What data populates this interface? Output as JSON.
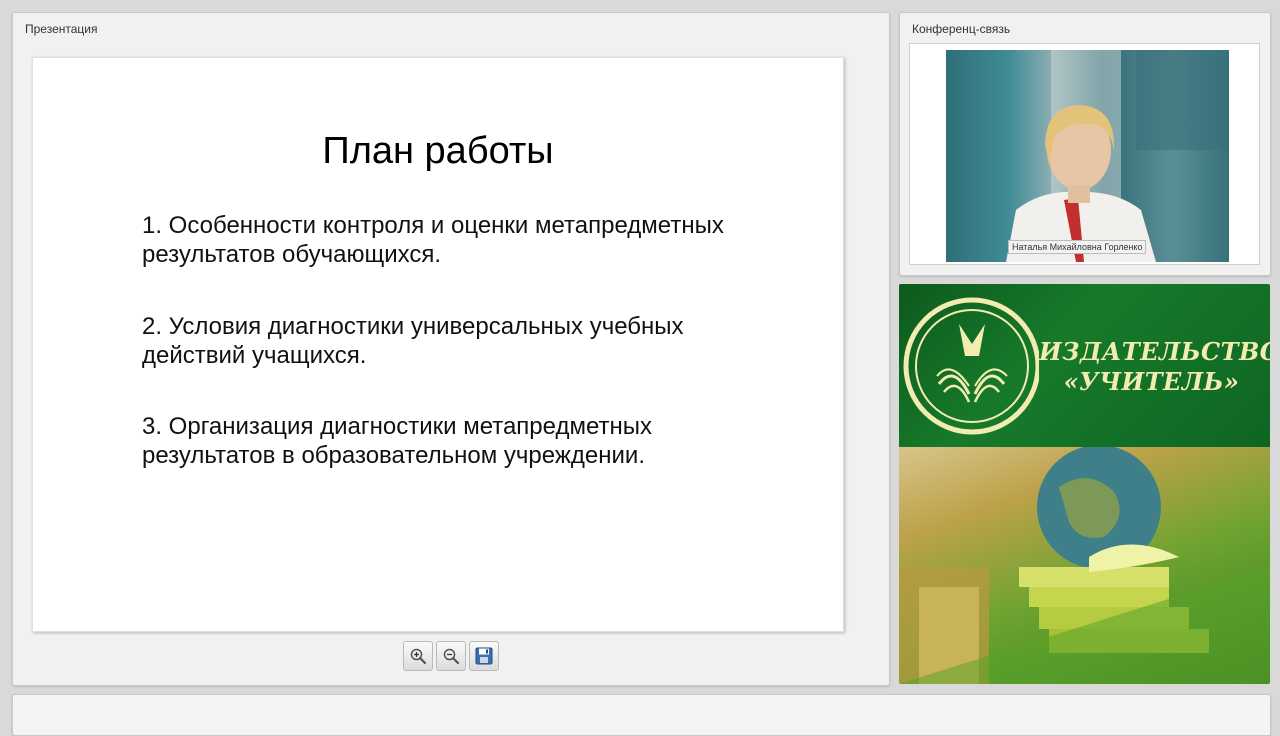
{
  "presentation": {
    "panel_title": "Презентация",
    "slide": {
      "title": "План работы",
      "items": [
        "1. Особенности контроля и оценки метапредметных результатов обучающихся.",
        "2. Условия диагностики универсальных учебных действий учащихся.",
        "3.  Организация диагностики метапредметных результатов в образовательном учреждении."
      ]
    },
    "toolbar": {
      "zoom_in_icon": "zoom-in-icon",
      "zoom_out_icon": "zoom-out-icon",
      "save_icon": "save-icon"
    }
  },
  "conference": {
    "panel_title": "Конференц-связь",
    "video_caption": "Наталья Михайловна Горленко"
  },
  "ad": {
    "line1": "ИЗДАТЕЛЬСТВО",
    "line2": "«УЧИТЕЛЬ»",
    "colors": {
      "green": "#167a2a",
      "cream": "#f3ecb0"
    }
  }
}
